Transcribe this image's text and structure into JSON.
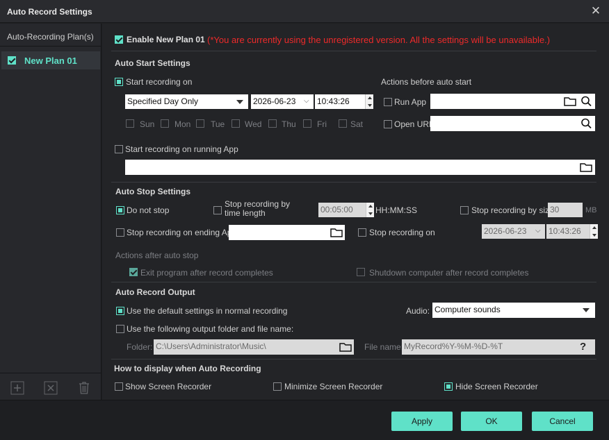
{
  "window": {
    "title": "Auto Record Settings"
  },
  "sidebar": {
    "header": "Auto-Recording Plan(s)",
    "plans": [
      {
        "label": "New Plan 01",
        "checked": true
      }
    ]
  },
  "header": {
    "enable_label": "Enable New Plan 01",
    "warning": "(*You are currently using the unregistered version. All the settings will be unavailable.)"
  },
  "auto_start": {
    "title": "Auto Start Settings",
    "start_recording_on": "Start recording on",
    "mode": "Specified Day Only",
    "date": "2026-06-23",
    "time": "10:43:26",
    "days": [
      "Sun",
      "Mon",
      "Tue",
      "Wed",
      "Thu",
      "Fri",
      "Sat"
    ],
    "actions_before": "Actions before auto start",
    "run_app": "Run App",
    "open_url": "Open URL",
    "start_on_running_app": "Start recording on running App"
  },
  "auto_stop": {
    "title": "Auto Stop Settings",
    "do_not_stop": "Do not stop",
    "stop_by_time": "Stop recording by time length",
    "time_length": "00:05:00",
    "time_format": "HH:MM:SS",
    "stop_by_size": "Stop recording by size",
    "size_value": "30",
    "size_unit": "MB",
    "stop_on_ending_app": "Stop recording on ending App",
    "stop_recording_on": "Stop recording on",
    "stop_date": "2026-06-23",
    "stop_time": "10:43:26",
    "actions_after": "Actions after auto stop",
    "exit_program": "Exit program after record completes",
    "shutdown": "Shutdown computer after record completes"
  },
  "output": {
    "title": "Auto Record Output",
    "use_default": "Use the default settings in normal recording",
    "audio_label": "Audio:",
    "audio_value": "Computer sounds",
    "use_following": "Use the following output folder and file name:",
    "folder_label": "Folder:",
    "folder_value": "C:\\Users\\Administrator\\Music\\",
    "filename_label": "File name:",
    "filename_value": "MyRecord%Y-%M-%D-%T"
  },
  "display": {
    "title": "How to display when Auto Recording",
    "show": "Show Screen Recorder",
    "minimize": "Minimize Screen Recorder",
    "hide": "Hide Screen Recorder"
  },
  "buttons": {
    "apply": "Apply",
    "ok": "OK",
    "cancel": "Cancel"
  },
  "colors": {
    "accent": "#5fe1c8",
    "warning": "#ee2a2a",
    "background": "#232427"
  },
  "icons": {
    "close": "close-icon",
    "folder": "folder-icon",
    "search": "search-icon",
    "help": "help-icon",
    "add": "add-icon",
    "delete": "delete-icon",
    "trash": "trash-icon"
  }
}
